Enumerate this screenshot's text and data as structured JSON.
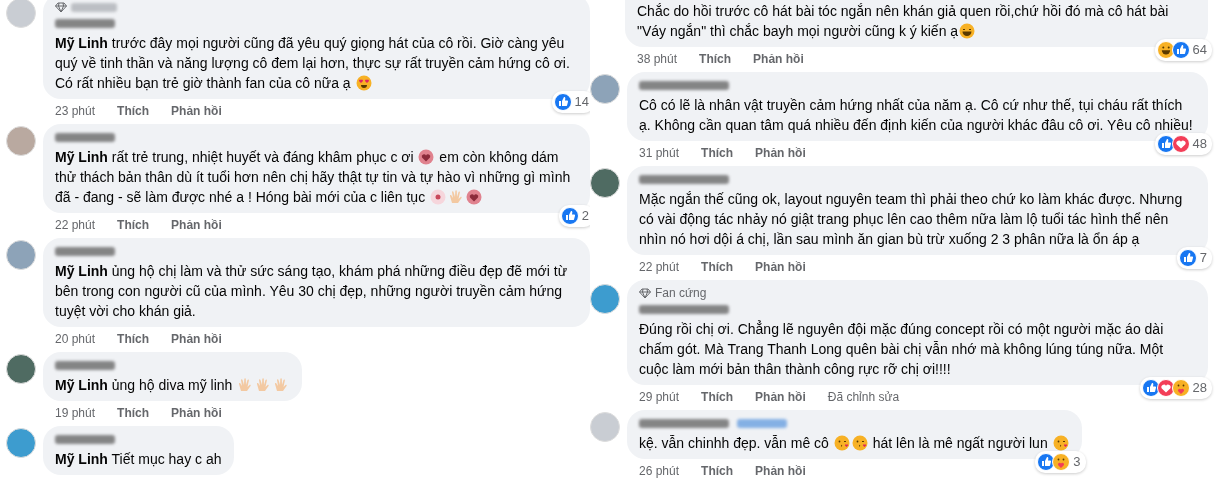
{
  "columns": [
    {
      "comments": [
        {
          "cut_top": false,
          "badge": {
            "kind": "blurred"
          },
          "follow_blurred": false,
          "segments": [
            {
              "kind": "text",
              "text": "**Mỹ Linh** trước đây mọi người cũng đã yêu quý giọng hát của cô rồi. Giờ càng yêu quý về tinh thần và năng lượng cô đem lại hơn, thực sự rất truyền cảm hứng cô ơi. Có rất nhiều bạn trẻ giờ thành fan của cô nữa ạ "
            },
            {
              "kind": "heart-eyes"
            }
          ],
          "time": "23 phút",
          "actions": [
            "Thích",
            "Phản hồi"
          ],
          "reactions": {
            "icons": [
              {
                "kind": "like"
              }
            ],
            "count": "14"
          }
        },
        {
          "cut_top": false,
          "follow_blurred": false,
          "segments": [
            {
              "kind": "text",
              "text": "**Mỹ Linh** rất trẻ trung, nhiệt huyết và đáng khâm phục c ơi "
            },
            {
              "kind": "heart"
            },
            {
              "kind": "text",
              "text": " em còn không dám thử thách bản thân dù ít tuổi hơn nên chị hãy thật tự tin và tự hào vì những gì mình đã - đang - sẽ làm được nhé a ! Hóng bài mới của c liên tục "
            },
            {
              "kind": "flower"
            },
            {
              "kind": "clap"
            },
            {
              "kind": "heart"
            }
          ],
          "time": "22 phút",
          "actions": [
            "Thích",
            "Phản hồi"
          ],
          "reactions": {
            "icons": [
              {
                "kind": "like"
              }
            ],
            "count": "2"
          }
        },
        {
          "cut_top": false,
          "follow_blurred": false,
          "segments": [
            {
              "kind": "text",
              "text": "**Mỹ Linh** ủng hộ chị làm và thử sức sáng tạo, khám phá những điều đẹp đẽ mới từ bên trong con người cũ của mình. Yêu 30 chị đẹp, những người truyền cảm hứng tuyệt vời cho khán giả."
            }
          ],
          "time": "20 phút",
          "actions": [
            "Thích",
            "Phản hồi"
          ]
        },
        {
          "cut_top": false,
          "follow_blurred": false,
          "segments": [
            {
              "kind": "text",
              "text": "**Mỹ Linh** ủng hộ diva mỹ linh "
            },
            {
              "kind": "clap"
            },
            {
              "kind": "clap"
            },
            {
              "kind": "clap"
            }
          ],
          "time": "19 phút",
          "actions": [
            "Thích",
            "Phản hồi"
          ]
        },
        {
          "cut_top": false,
          "follow_blurred": false,
          "segments": [
            {
              "kind": "text",
              "text": "**Mỹ Linh** Tiết mục hay c ah"
            }
          ]
        }
      ]
    },
    {
      "comments": [
        {
          "cut_top": true,
          "segments": [
            {
              "kind": "text",
              "text": "Chắc do hồi trước cô hát bài tóc ngắn nên khán giả quen rồi,chứ hồi đó mà cô hát bài \"Váy ngắn\" thì chắc bayh mọi người cũng k ý kiến ạ"
            },
            {
              "kind": "laugh"
            }
          ],
          "time": "38 phút",
          "actions": [
            "Thích",
            "Phản hồi"
          ],
          "reactions": {
            "icons": [
              {
                "kind": "haha"
              },
              {
                "kind": "like"
              }
            ],
            "count": "64"
          }
        },
        {
          "cut_top": false,
          "follow_blurred": false,
          "segments": [
            {
              "kind": "text",
              "text": "Cô có lẽ là nhân vật truyền cảm hứng nhất của năm ạ. Cô cứ như thế, tụi cháu rất thích ạ. Không cần quan tâm quá nhiều đến định kiến của người khác đâu cô ơi. Yêu cô nhiều!"
            }
          ],
          "time": "31 phút",
          "actions": [
            "Thích",
            "Phản hồi"
          ],
          "reactions": {
            "icons": [
              {
                "kind": "like"
              },
              {
                "kind": "love"
              }
            ],
            "count": "48"
          }
        },
        {
          "cut_top": false,
          "follow_blurred": false,
          "segments": [
            {
              "kind": "text",
              "text": "Mặc ngắn thế cũng ok, layout nguyên team thì phải theo chứ ko làm khác được. Nhưng có vài động tác nhảy nó giật trang phục lên cao thêm nữa làm lộ tuổi tác hình thể nên nhìn nó hơi dội á chị, lần sau mình ăn gian bù trừ xuống 2 3 phân nữa là ổn áp ạ"
            }
          ],
          "time": "22 phút",
          "actions": [
            "Thích",
            "Phản hồi"
          ],
          "reactions": {
            "icons": [
              {
                "kind": "like"
              }
            ],
            "count": "7"
          }
        },
        {
          "cut_top": false,
          "badge": {
            "kind": "text",
            "text": "Fan cứng"
          },
          "follow_blurred": false,
          "segments": [
            {
              "kind": "text",
              "text": "Đúng rồi chị ơi. Chẳng lẽ nguyên đội mặc đúng concept rồi có một người mặc áo dài chấm gót. Mà Trang Thanh Long quên bài chị vẫn nhớ mà không lúng túng nữa. Một cuộc làm mới bản thân thành công rực rỡ chị ơi!!!!"
            }
          ],
          "time": "29 phút",
          "actions": [
            "Thích",
            "Phản hồi"
          ],
          "edited": "Đã chỉnh sửa",
          "reactions": {
            "icons": [
              {
                "kind": "like"
              },
              {
                "kind": "love"
              },
              {
                "kind": "care"
              }
            ],
            "count": "28"
          }
        },
        {
          "cut_top": false,
          "follow_blurred": true,
          "segments": [
            {
              "kind": "text",
              "text": "kệ. vẫn chinhh đẹp. vẫn mê cô "
            },
            {
              "kind": "kiss"
            },
            {
              "kind": "kiss"
            },
            {
              "kind": "text",
              "text": " hát lên là mê ngất người lun "
            },
            {
              "kind": "kiss"
            }
          ],
          "time": "26 phút",
          "actions": [
            "Thích",
            "Phản hồi"
          ],
          "reactions": {
            "icons": [
              {
                "kind": "like"
              },
              {
                "kind": "care"
              }
            ],
            "count": "3"
          }
        }
      ]
    }
  ]
}
